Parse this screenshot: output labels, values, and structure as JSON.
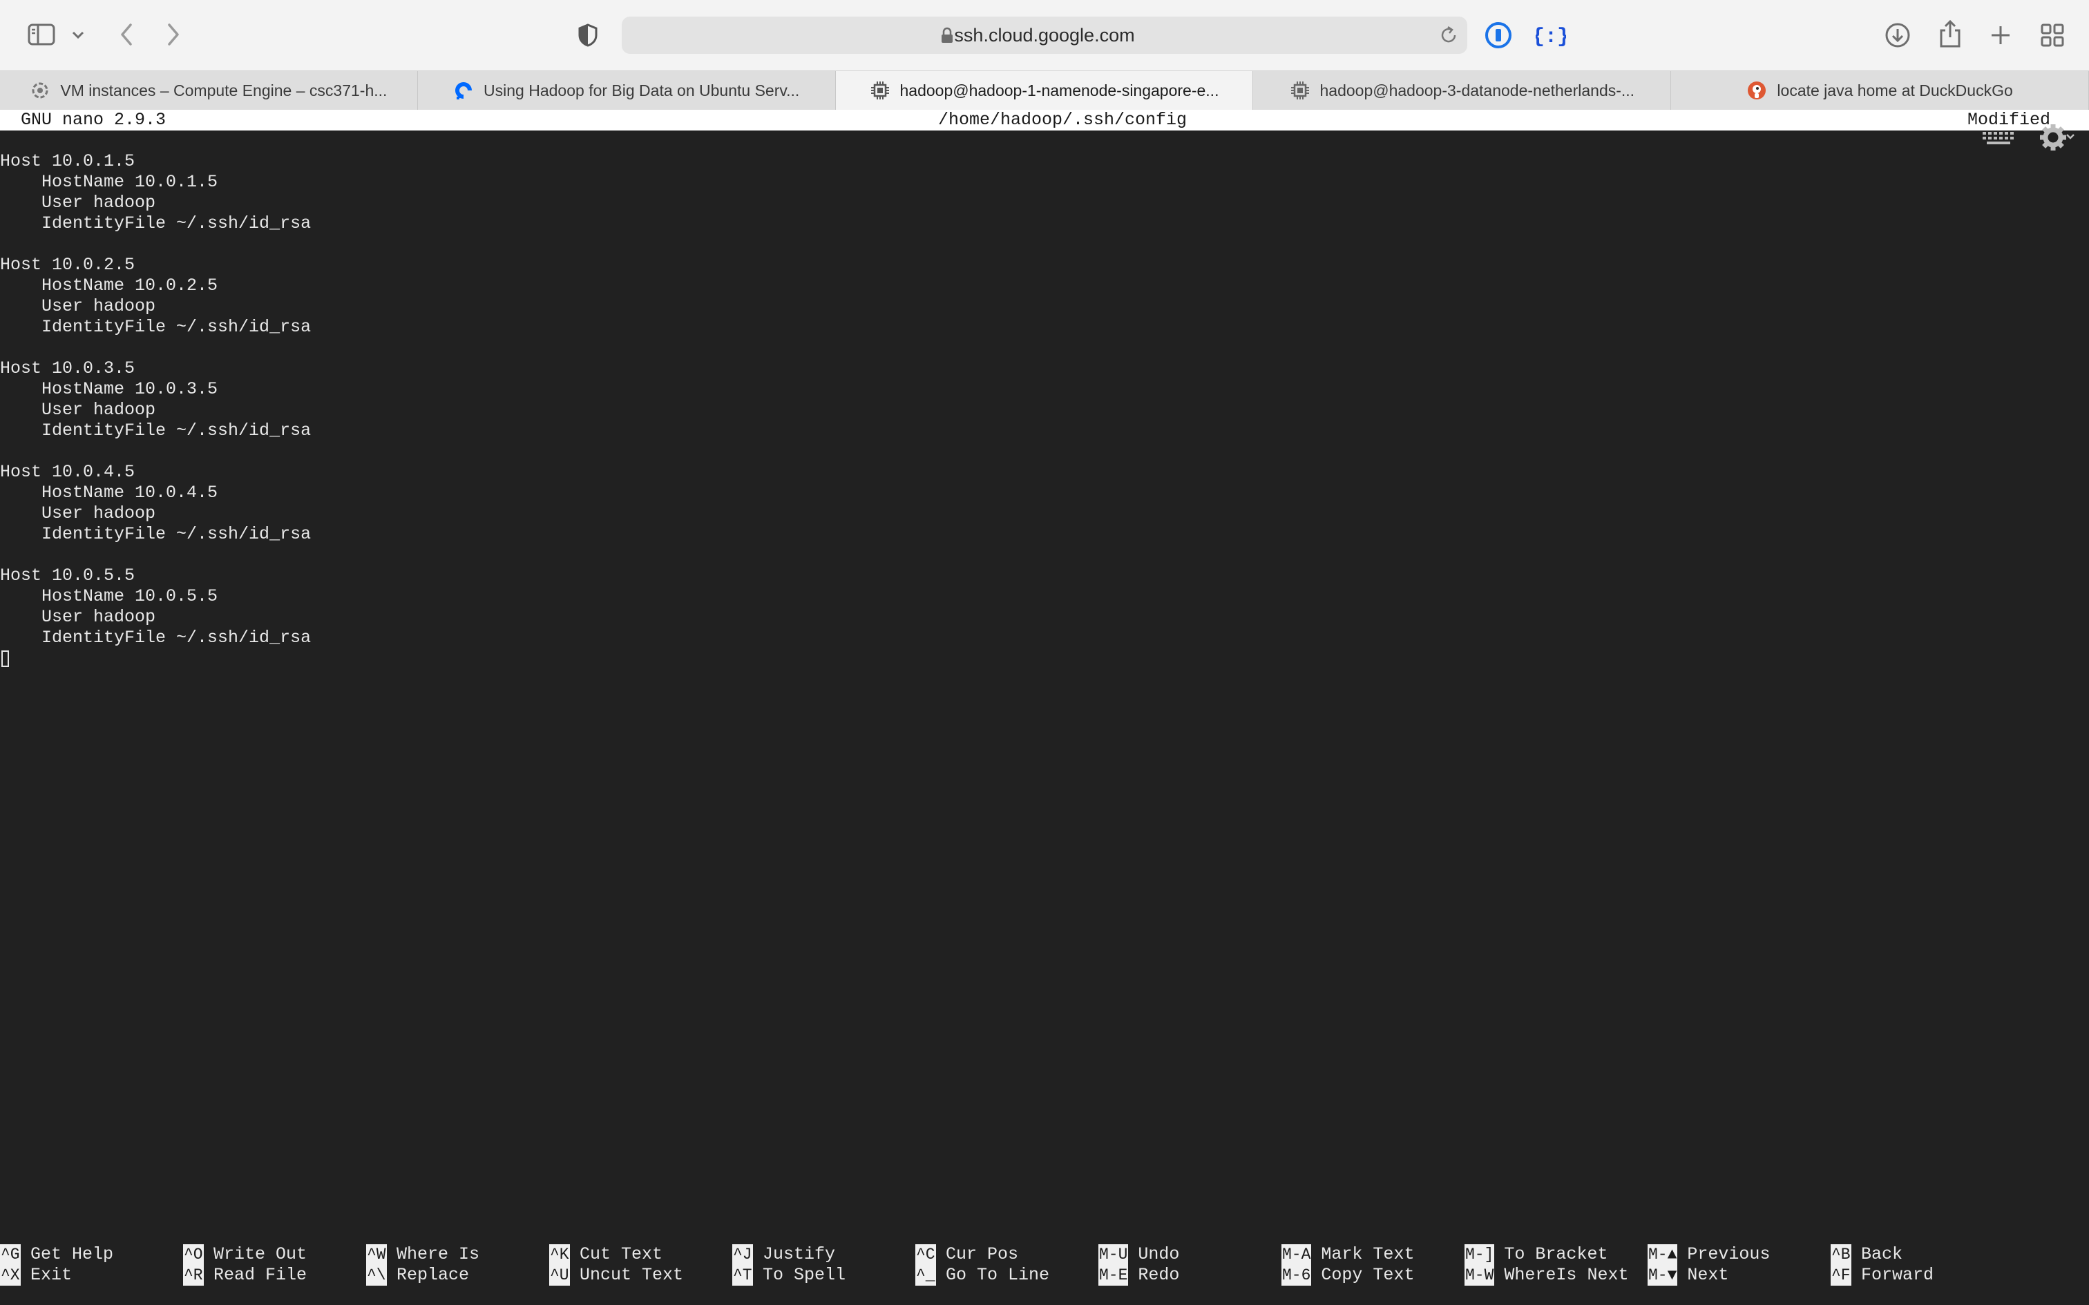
{
  "browser": {
    "url": "ssh.cloud.google.com",
    "tabs": [
      {
        "title": "VM instances – Compute Engine – csc371-h...",
        "icon": "gcp-icon"
      },
      {
        "title": "Using Hadoop for Big Data on Ubuntu Serv...",
        "icon": "digitalocean-icon"
      },
      {
        "title": "hadoop@hadoop-1-namenode-singapore-e...",
        "icon": "chip-icon",
        "active": true
      },
      {
        "title": "hadoop@hadoop-3-datanode-netherlands-...",
        "icon": "chip-icon"
      },
      {
        "title": "locate java home at DuckDuckGo",
        "icon": "duckduckgo-icon"
      }
    ]
  },
  "nano": {
    "version": "GNU nano 2.9.3",
    "file_path": "/home/hadoop/.ssh/config",
    "status": "Modified"
  },
  "file_content": "Host 10.0.1.5\n    HostName 10.0.1.5\n    User hadoop\n    IdentityFile ~/.ssh/id_rsa\n\nHost 10.0.2.5\n    HostName 10.0.2.5\n    User hadoop\n    IdentityFile ~/.ssh/id_rsa\n\nHost 10.0.3.5\n    HostName 10.0.3.5\n    User hadoop\n    IdentityFile ~/.ssh/id_rsa\n\nHost 10.0.4.5\n    HostName 10.0.4.5\n    User hadoop\n    IdentityFile ~/.ssh/id_rsa\n\nHost 10.0.5.5\n    HostName 10.0.5.5\n    User hadoop\n    IdentityFile ~/.ssh/id_rsa",
  "shortcuts": [
    {
      "key": "^G",
      "label": "Get Help"
    },
    {
      "key": "^O",
      "label": "Write Out"
    },
    {
      "key": "^W",
      "label": "Where Is"
    },
    {
      "key": "^K",
      "label": "Cut Text"
    },
    {
      "key": "^J",
      "label": "Justify"
    },
    {
      "key": "^C",
      "label": "Cur Pos"
    },
    {
      "key": "M-U",
      "label": "Undo"
    },
    {
      "key": "M-A",
      "label": "Mark Text"
    },
    {
      "key": "M-]",
      "label": "To Bracket"
    },
    {
      "key": "M-▲",
      "label": "Previous"
    },
    {
      "key": "^B",
      "label": "Back"
    },
    {
      "key": "^X",
      "label": "Exit"
    },
    {
      "key": "^R",
      "label": "Read File"
    },
    {
      "key": "^\\",
      "label": "Replace"
    },
    {
      "key": "^U",
      "label": "Uncut Text"
    },
    {
      "key": "^T",
      "label": "To Spell"
    },
    {
      "key": "^_",
      "label": "Go To Line"
    },
    {
      "key": "M-E",
      "label": "Redo"
    },
    {
      "key": "M-6",
      "label": "Copy Text"
    },
    {
      "key": "M-W",
      "label": "WhereIs Next"
    },
    {
      "key": "M-▼",
      "label": "Next"
    },
    {
      "key": "^F",
      "label": "Forward"
    }
  ]
}
